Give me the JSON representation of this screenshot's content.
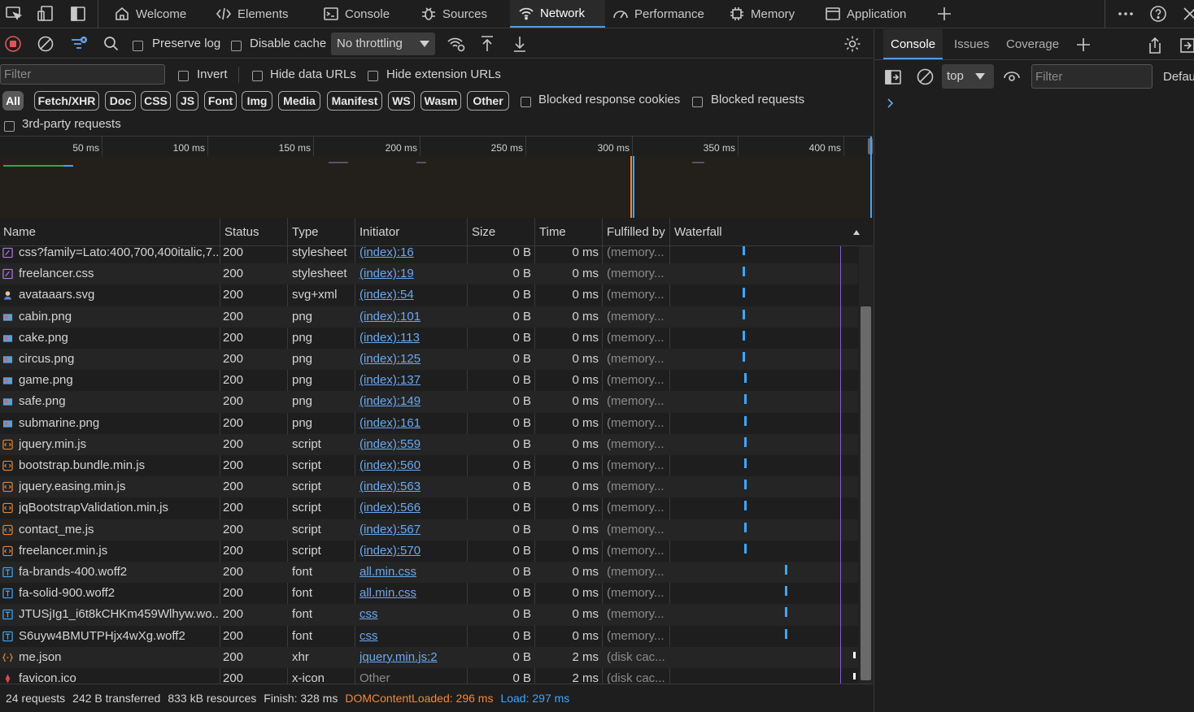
{
  "tabs": [
    {
      "label": "Welcome",
      "icon": "home-icon"
    },
    {
      "label": "Elements",
      "icon": "code-icon"
    },
    {
      "label": "Console",
      "icon": "console-icon"
    },
    {
      "label": "Sources",
      "icon": "bug-icon"
    },
    {
      "label": "Network",
      "icon": "wifi-icon",
      "active": true
    },
    {
      "label": "Performance",
      "icon": "performance-icon"
    },
    {
      "label": "Memory",
      "icon": "chip-icon"
    },
    {
      "label": "Application",
      "icon": "window-icon"
    }
  ],
  "toolbar": {
    "preserve_log": "Preserve log",
    "disable_cache": "Disable cache",
    "throttling": "No throttling"
  },
  "filterbar": {
    "filter_placeholder": "Filter",
    "invert": "Invert",
    "hide_data_urls": "Hide data URLs",
    "hide_extension_urls": "Hide extension URLs"
  },
  "type_filters": [
    "All",
    "Fetch/XHR",
    "Doc",
    "CSS",
    "JS",
    "Font",
    "Img",
    "Media",
    "Manifest",
    "WS",
    "Wasm",
    "Other"
  ],
  "blocked_response_cookies": "Blocked response cookies",
  "blocked_requests": "Blocked requests",
  "third_party": "3rd-party requests",
  "overview_ticks": [
    "50 ms",
    "100 ms",
    "150 ms",
    "200 ms",
    "250 ms",
    "300 ms",
    "350 ms",
    "400 ms"
  ],
  "columns": [
    "Name",
    "Status",
    "Type",
    "Initiator",
    "Size",
    "Time",
    "Fulfilled by",
    "Waterfall"
  ],
  "requests": [
    {
      "name": "css?family=Lato:400,700,400italic,7...",
      "status": "200",
      "type": "stylesheet",
      "initiator": "(index):16",
      "size": "0 B",
      "time": "0 ms",
      "fulfilled": "(memory...",
      "icon": "stylesheet-icon",
      "wf": 0.38
    },
    {
      "name": "freelancer.css",
      "status": "200",
      "type": "stylesheet",
      "initiator": "(index):19",
      "size": "0 B",
      "time": "0 ms",
      "fulfilled": "(memory...",
      "icon": "stylesheet-icon",
      "wf": 0.38
    },
    {
      "name": "avataaars.svg",
      "status": "200",
      "type": "svg+xml",
      "initiator": "(index):54",
      "size": "0 B",
      "time": "0 ms",
      "fulfilled": "(memory...",
      "icon": "avatar-icon",
      "wf": 0.38
    },
    {
      "name": "cabin.png",
      "status": "200",
      "type": "png",
      "initiator": "(index):101",
      "size": "0 B",
      "time": "0 ms",
      "fulfilled": "(memory...",
      "icon": "image-icon",
      "wf": 0.38
    },
    {
      "name": "cake.png",
      "status": "200",
      "type": "png",
      "initiator": "(index):113",
      "size": "0 B",
      "time": "0 ms",
      "fulfilled": "(memory...",
      "icon": "image-icon",
      "wf": 0.38
    },
    {
      "name": "circus.png",
      "status": "200",
      "type": "png",
      "initiator": "(index):125",
      "size": "0 B",
      "time": "0 ms",
      "fulfilled": "(memory...",
      "icon": "image-icon",
      "wf": 0.38
    },
    {
      "name": "game.png",
      "status": "200",
      "type": "png",
      "initiator": "(index):137",
      "size": "0 B",
      "time": "0 ms",
      "fulfilled": "(memory...",
      "icon": "image-icon",
      "wf": 0.39
    },
    {
      "name": "safe.png",
      "status": "200",
      "type": "png",
      "initiator": "(index):149",
      "size": "0 B",
      "time": "0 ms",
      "fulfilled": "(memory...",
      "icon": "image-icon",
      "wf": 0.39
    },
    {
      "name": "submarine.png",
      "status": "200",
      "type": "png",
      "initiator": "(index):161",
      "size": "0 B",
      "time": "0 ms",
      "fulfilled": "(memory...",
      "icon": "image-icon",
      "wf": 0.39
    },
    {
      "name": "jquery.min.js",
      "status": "200",
      "type": "script",
      "initiator": "(index):559",
      "size": "0 B",
      "time": "0 ms",
      "fulfilled": "(memory...",
      "icon": "script-icon",
      "wf": 0.39
    },
    {
      "name": "bootstrap.bundle.min.js",
      "status": "200",
      "type": "script",
      "initiator": "(index):560",
      "size": "0 B",
      "time": "0 ms",
      "fulfilled": "(memory...",
      "icon": "script-icon",
      "wf": 0.39
    },
    {
      "name": "jquery.easing.min.js",
      "status": "200",
      "type": "script",
      "initiator": "(index):563",
      "size": "0 B",
      "time": "0 ms",
      "fulfilled": "(memory...",
      "icon": "script-icon",
      "wf": 0.39
    },
    {
      "name": "jqBootstrapValidation.min.js",
      "status": "200",
      "type": "script",
      "initiator": "(index):566",
      "size": "0 B",
      "time": "0 ms",
      "fulfilled": "(memory...",
      "icon": "script-icon",
      "wf": 0.39
    },
    {
      "name": "contact_me.js",
      "status": "200",
      "type": "script",
      "initiator": "(index):567",
      "size": "0 B",
      "time": "0 ms",
      "fulfilled": "(memory...",
      "icon": "script-icon",
      "wf": 0.39
    },
    {
      "name": "freelancer.min.js",
      "status": "200",
      "type": "script",
      "initiator": "(index):570",
      "size": "0 B",
      "time": "0 ms",
      "fulfilled": "(memory...",
      "icon": "script-icon",
      "wf": 0.39
    },
    {
      "name": "fa-brands-400.woff2",
      "status": "200",
      "type": "font",
      "initiator": "all.min.css",
      "size": "0 B",
      "time": "0 ms",
      "fulfilled": "(memory...",
      "icon": "font-icon",
      "wf": 0.61
    },
    {
      "name": "fa-solid-900.woff2",
      "status": "200",
      "type": "font",
      "initiator": "all.min.css",
      "size": "0 B",
      "time": "0 ms",
      "fulfilled": "(memory...",
      "icon": "font-icon",
      "wf": 0.61
    },
    {
      "name": "JTUSjIg1_i6t8kCHKm459Wlhyw.wo...",
      "status": "200",
      "type": "font",
      "initiator": "css",
      "size": "0 B",
      "time": "0 ms",
      "fulfilled": "(memory...",
      "icon": "font-icon",
      "wf": 0.61
    },
    {
      "name": "S6uyw4BMUTPHjx4wXg.woff2",
      "status": "200",
      "type": "font",
      "initiator": "css",
      "size": "0 B",
      "time": "0 ms",
      "fulfilled": "(memory...",
      "icon": "font-icon",
      "wf": 0.61
    },
    {
      "name": "me.json",
      "status": "200",
      "type": "xhr",
      "initiator": "jquery.min.js:2",
      "size": "0 B",
      "time": "2 ms",
      "fulfilled": "(disk cac...",
      "icon": "json-icon",
      "wf": 0.98
    },
    {
      "name": "favicon.ico",
      "status": "200",
      "type": "x-icon",
      "initiator": "Other",
      "size": "0 B",
      "time": "2 ms",
      "fulfilled": "(disk cac...",
      "icon": "favicon-icon",
      "wf": 0.98,
      "initiator_plain": true
    }
  ],
  "status_bar": {
    "requests": "24 requests",
    "transferred": "242 B transferred",
    "resources": "833 kB resources",
    "finish": "Finish: 328 ms",
    "dcl": "DOMContentLoaded: 296 ms",
    "load": "Load: 297 ms"
  },
  "colors": {
    "accent": "#4f9be8",
    "link": "#6aa8f0",
    "dcl": "#f0883e",
    "load": "#3ea6ff",
    "waterfall_bar": "#3ea6ff"
  },
  "drawer": {
    "tabs": [
      "Console",
      "Issues",
      "Coverage"
    ],
    "context": "top",
    "filter_placeholder": "Filter",
    "levels": "Defau"
  }
}
